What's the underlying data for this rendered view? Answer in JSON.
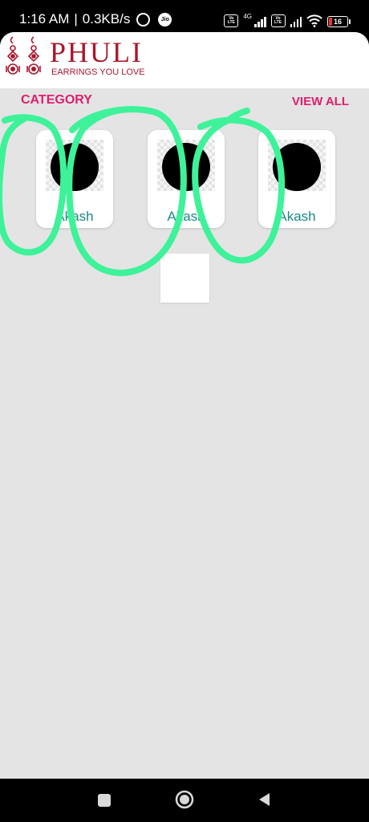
{
  "status_bar": {
    "time": "1:16 AM",
    "separator": "|",
    "speed": "0.3KB/s",
    "jio_label": "Jio",
    "volte_label": "Vo LTE",
    "network_tag": "4G",
    "battery_level": "16",
    "icons": [
      "alarm-icon",
      "jio-icon",
      "volte-icon",
      "signal-icon",
      "wifi-icon",
      "battery-icon"
    ]
  },
  "header": {
    "brand_name": "PHULI",
    "tagline": "EARRINGS YOU LOVE",
    "brand_color": "#a8172d",
    "logo_icon": "earrings-icon"
  },
  "category": {
    "title": "CATEGORY",
    "view_all_label": "VIEW ALL",
    "accent_color": "#de1f6e",
    "label_color": "#1a8a86",
    "items": [
      {
        "label": "Akash"
      },
      {
        "label": "Akash"
      },
      {
        "label": "Akash"
      }
    ]
  },
  "annotation": {
    "stroke_color": "#3ef29a"
  },
  "nav_bar": {
    "icons": [
      "recents-square-icon",
      "home-circle-icon",
      "back-triangle-icon"
    ]
  }
}
